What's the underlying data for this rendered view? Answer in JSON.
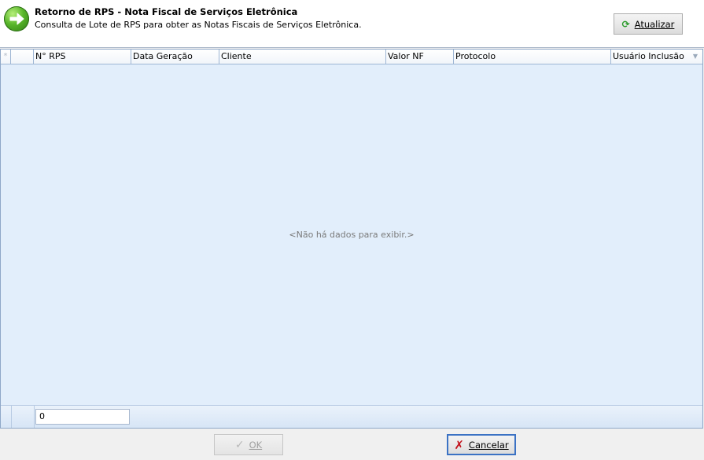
{
  "header": {
    "title": "Retorno de RPS - Nota Fiscal de Serviços Eletrônica",
    "subtitle": "Consulta de Lote de RPS para obter as Notas Fiscais de Serviços Eletrônica.",
    "icon": "arrow-right-icon",
    "refresh_label": "Atualizar",
    "refresh_icon": "refresh-icon"
  },
  "grid": {
    "indicator": "*",
    "columns": [
      "N° RPS",
      "Data Geração",
      "Cliente",
      "Valor NF",
      "Protocolo",
      "Usuário Inclusão"
    ],
    "empty_text": "<Não há dados para exibir.>",
    "footer_count": "0"
  },
  "footer": {
    "ok_label": "OK",
    "cancel_label": "Cancelar"
  },
  "colors": {
    "grid_background": "#e2eefb",
    "accent_border": "#3b72c4",
    "cancel_icon": "#c3111a"
  }
}
